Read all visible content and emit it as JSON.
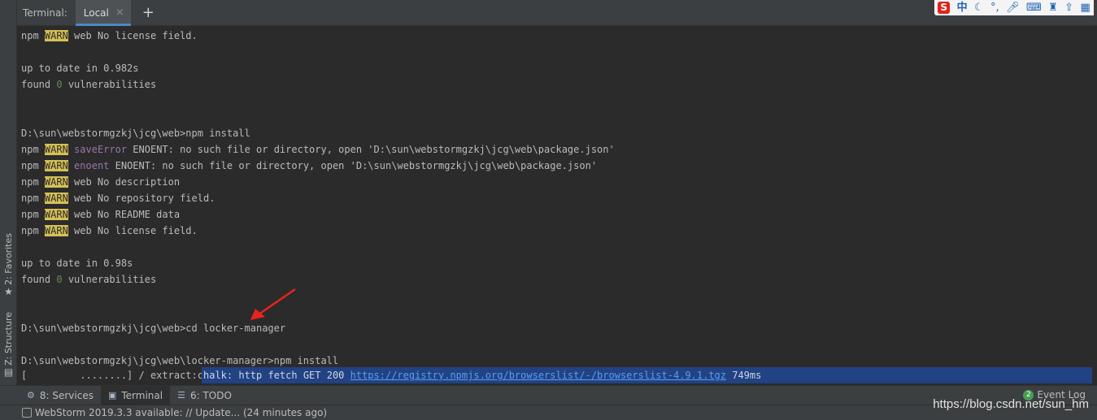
{
  "tabbar": {
    "title": "Terminal:",
    "tabs": [
      {
        "label": "Local"
      }
    ],
    "close_glyph": "×",
    "add_glyph": "+"
  },
  "ime": {
    "logo": "S",
    "lang": "中",
    "icons": [
      "moon-icon",
      "punctuation-icon",
      "microphone-icon",
      "keyboard-icon",
      "shirt-icon",
      "upload-icon",
      "grid-icon"
    ]
  },
  "left_strip": {
    "favorites": {
      "label": "2: Favorites",
      "icon": "star-icon"
    },
    "structure": {
      "label": "Z: Structure",
      "icon": "structure-icon"
    }
  },
  "terminal": {
    "lines": [
      [
        {
          "t": "npm "
        },
        {
          "t": "WARN",
          "c": "warn"
        },
        {
          "t": " web No license field."
        }
      ],
      [],
      [
        {
          "t": "up to date in 0.982s"
        }
      ],
      [
        {
          "t": "found "
        },
        {
          "t": "0",
          "c": "green"
        },
        {
          "t": " vulnerabilities"
        }
      ],
      [],
      [],
      [
        {
          "t": "D:\\sun\\webstormgzkj\\jcg\\web>npm install"
        }
      ],
      [
        {
          "t": "npm "
        },
        {
          "t": "WARN",
          "c": "warn"
        },
        {
          "t": " "
        },
        {
          "t": "saveError",
          "c": "purple"
        },
        {
          "t": " ENOENT: no such file or directory, open 'D:\\sun\\webstormgzkj\\jcg\\web\\package.json'"
        }
      ],
      [
        {
          "t": "npm "
        },
        {
          "t": "WARN",
          "c": "warn"
        },
        {
          "t": " "
        },
        {
          "t": "enoent",
          "c": "purple"
        },
        {
          "t": " ENOENT: no such file or directory, open 'D:\\sun\\webstormgzkj\\jcg\\web\\package.json'"
        }
      ],
      [
        {
          "t": "npm "
        },
        {
          "t": "WARN",
          "c": "warn"
        },
        {
          "t": " web No description"
        }
      ],
      [
        {
          "t": "npm "
        },
        {
          "t": "WARN",
          "c": "warn"
        },
        {
          "t": " web No repository field."
        }
      ],
      [
        {
          "t": "npm "
        },
        {
          "t": "WARN",
          "c": "warn"
        },
        {
          "t": " web No README data"
        }
      ],
      [
        {
          "t": "npm "
        },
        {
          "t": "WARN",
          "c": "warn"
        },
        {
          "t": " web No license field."
        }
      ],
      [],
      [
        {
          "t": "up to date in 0.98s"
        }
      ],
      [
        {
          "t": "found "
        },
        {
          "t": "0",
          "c": "green"
        },
        {
          "t": " vulnerabilities"
        }
      ],
      [],
      [],
      [
        {
          "t": "D:\\sun\\webstormgzkj\\jcg\\web>cd locker-manager"
        }
      ],
      [],
      [
        {
          "t": "D:\\sun\\webstormgzkj\\jcg\\web\\locker-manager>npm install"
        }
      ]
    ],
    "progress": {
      "left": "[         ........] / extract:c",
      "middle": "halk: http fetch GET 200 ",
      "url": "https://registry.npmjs.org/browserslist/-/browserslist-4.9.1.tgz",
      "time": " 749ms"
    }
  },
  "bottom_tabs": [
    {
      "label": "8: Services",
      "icon": "services-icon",
      "glyph": "⚙",
      "active": false
    },
    {
      "label": "Terminal",
      "icon": "terminal-icon",
      "glyph": "▣",
      "active": true
    },
    {
      "label": "6: TODO",
      "icon": "todo-icon",
      "glyph": "☰",
      "active": false
    }
  ],
  "event_log": {
    "count": "2",
    "label": "Event Log"
  },
  "status": {
    "text": "WebStorm 2019.3.3 available: // Update... (24 minutes ago)"
  },
  "watermark": "https://blog.csdn.net/sun_hm",
  "colors": {
    "accent": "#4a88c7",
    "warn_bg": "#d6bf55",
    "progress_bg": "#214283",
    "arrow": "#e8231b"
  }
}
